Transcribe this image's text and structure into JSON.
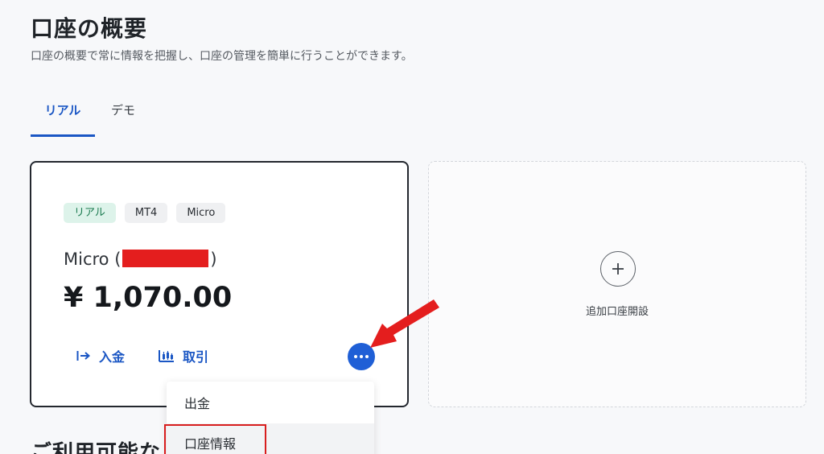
{
  "header": {
    "title": "口座の概要",
    "subtitle": "口座の概要で常に情報を把握し、口座の管理を簡単に行うことができます。"
  },
  "tabs": [
    {
      "label": "リアル",
      "active": true
    },
    {
      "label": "デモ",
      "active": false
    }
  ],
  "account_card": {
    "badges": [
      "リアル",
      "MT4",
      "Micro"
    ],
    "name_prefix": "Micro (",
    "name_suffix": ")",
    "balance": "¥ 1,070.00",
    "actions": {
      "deposit": "入金",
      "trade": "取引"
    }
  },
  "add_account": {
    "label": "追加口座開設"
  },
  "dropdown": {
    "items": [
      "出金",
      "口座情報"
    ]
  },
  "section_cut": {
    "text": "ご利用可能な"
  },
  "colors": {
    "accent": "#1a56c4",
    "more_button": "#1f5fd6",
    "annotation_red": "#e41e1e",
    "real_badge_bg": "#ddf3ea"
  }
}
